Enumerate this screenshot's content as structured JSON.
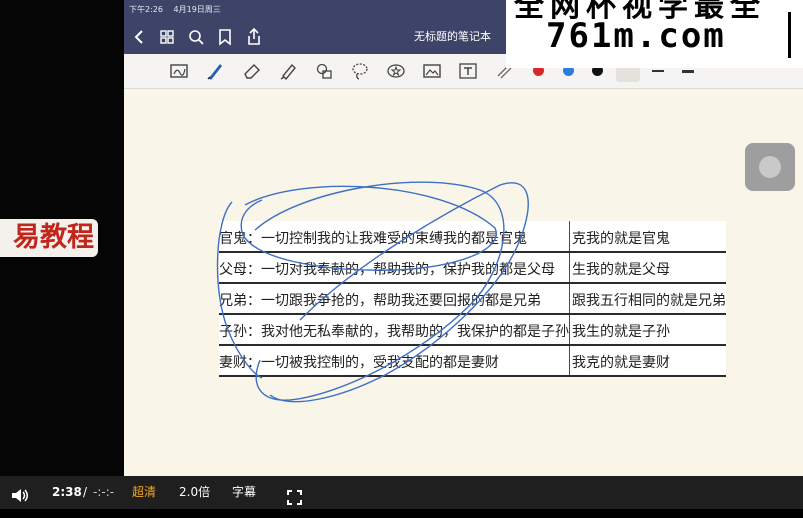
{
  "status_bar": {
    "time": "下午2:26",
    "date": "4月19日周三"
  },
  "nav": {
    "title": "无标题的笔记本",
    "icons": [
      "back-chevron-icon",
      "grid-icon",
      "search-icon",
      "bookmark-icon",
      "share-icon"
    ]
  },
  "toolbar": {
    "tools": [
      "lasso-text-icon",
      "pen-icon",
      "eraser-icon",
      "highlighter-icon",
      "shapes-icon",
      "lasso-icon",
      "sticker-icon",
      "image-icon",
      "text-box-icon",
      "more-tool-icon"
    ],
    "colors": [
      "#d92626",
      "#2a7de1",
      "#111111"
    ]
  },
  "watermark": {
    "left_tag": "易教程",
    "site_top": "全网杯视学最全",
    "site_main": "761m.com"
  },
  "note_table": {
    "rows": [
      {
        "left": "官鬼：一切控制我的让我难受的束缚我的都是官鬼",
        "right": "克我的就是官鬼"
      },
      {
        "left": "父母：一切对我奉献的，帮助我的，保护我的都是父母",
        "right": "生我的就是父母"
      },
      {
        "left": "兄弟：一切跟我争抢的，帮助我还要回报的都是兄弟",
        "right": "跟我五行相同的就是兄弟"
      },
      {
        "left": "子孙：我对他无私奉献的，我帮助的，我保护的都是子孙",
        "right": "我生的就是子孙"
      },
      {
        "left": "妻财：一切被我控制的，受我支配的都是妻财",
        "right": "我克的就是妻财"
      }
    ]
  },
  "player": {
    "current_time": "2:38",
    "separator": "/",
    "total_time": "-:-:-",
    "quality": "超清",
    "speed": "2.0倍",
    "subtitles": "字幕"
  }
}
